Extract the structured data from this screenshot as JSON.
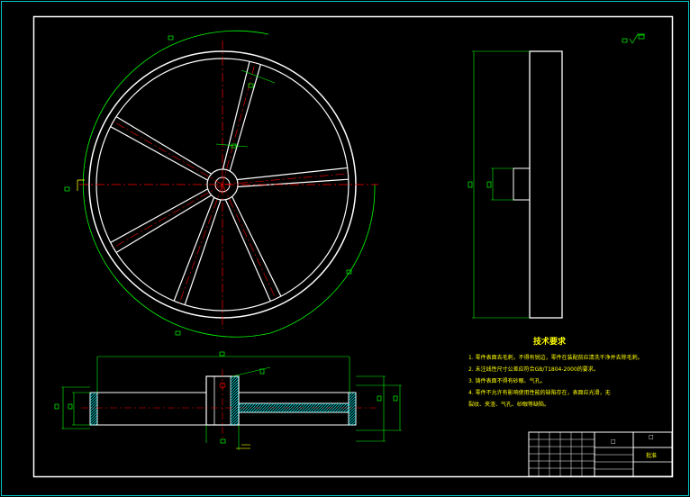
{
  "colors": {
    "background": "#000000",
    "frame": "#ffffff",
    "outer_border": "#00c8c8",
    "dimension": "#00ff00",
    "centerline": "#ff0000",
    "hatch": "#00ffff",
    "text": "#ffff00"
  },
  "tech_requirements": {
    "title": "技术要求",
    "items": [
      "1. 零件表面去毛刺，不得有锐边，零件在装配前应清洗干净并去除毛刺。",
      "2. 未注线性尺寸公差应符合GB/T1804-2000的要求。",
      "3. 铸件表面不得有砂眼、气孔。",
      "4. 零件不允许有影响使用性能的缺陷存在，表面应光滑，无",
      "裂纹、夹渣、气孔、砂眼等缺陷。"
    ]
  },
  "title_block": {
    "drawing_name": "□",
    "drawing_code": "□",
    "code_label": "批准"
  },
  "symbols": {
    "roughness": "□√"
  }
}
